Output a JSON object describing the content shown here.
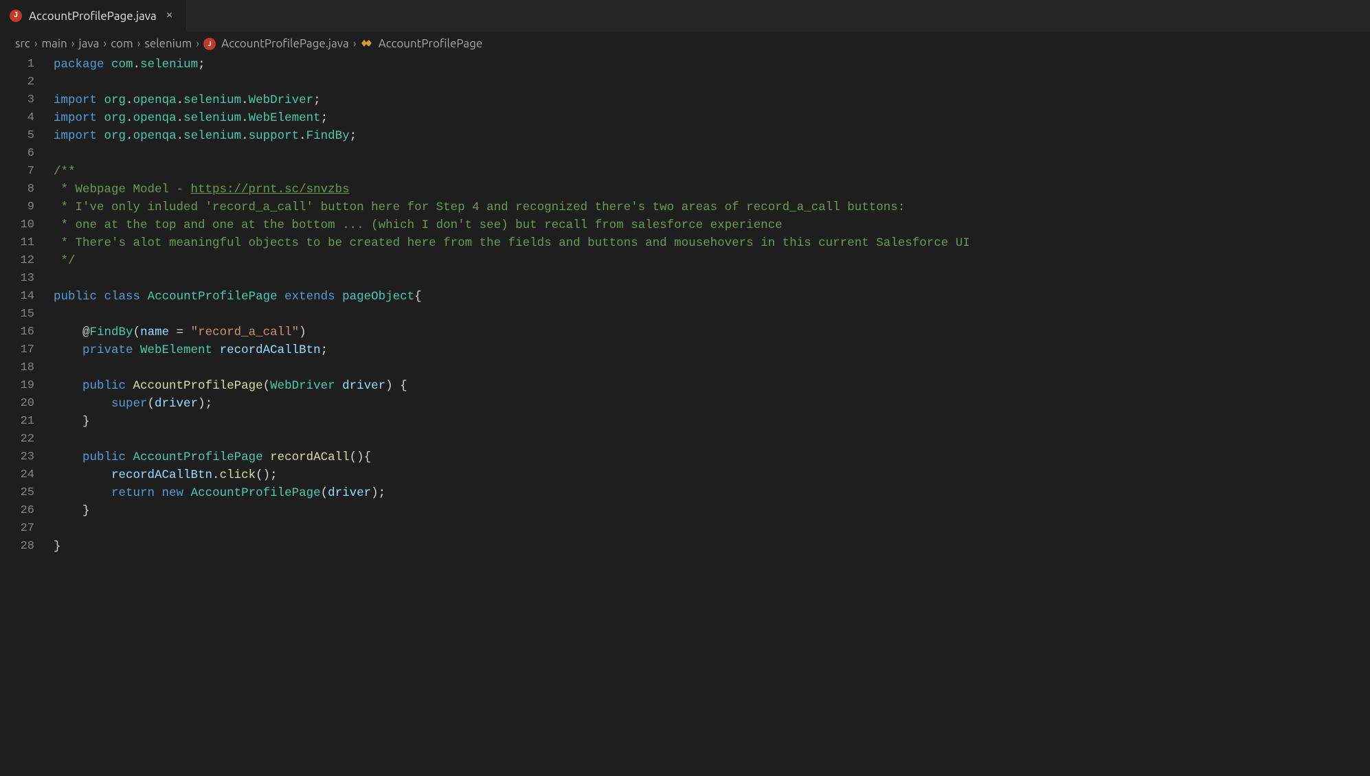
{
  "tab": {
    "label": "AccountProfilePage.java",
    "icon_letter": "J",
    "close_glyph": "×"
  },
  "breadcrumb": {
    "items": [
      "src",
      "main",
      "java",
      "com",
      "selenium"
    ],
    "file": "AccountProfilePage.java",
    "file_icon_letter": "J",
    "symbol": "AccountProfilePage"
  },
  "code": {
    "line_count": 28,
    "lines": {
      "l1_pkg_kw": "package",
      "l1_pkg_ns1": "com",
      "l1_pkg_ns2": "selenium",
      "l3_import_kw": "import",
      "l3_p1": "org",
      "l3_p2": "openqa",
      "l3_p3": "selenium",
      "l3_cls": "WebDriver",
      "l4_p1": "org",
      "l4_p2": "openqa",
      "l4_p3": "selenium",
      "l4_cls": "WebElement",
      "l5_p1": "org",
      "l5_p2": "openqa",
      "l5_p3": "selenium",
      "l5_p4": "support",
      "l5_cls": "FindBy",
      "l7_c": "/**",
      "l8_c_pre": " * Webpage Model - ",
      "l8_c_link": "https://prnt.sc/snvzbs",
      "l9_c": " * I've only inluded 'record_a_call' button here for Step 4 and recognized there's two areas of record_a_call buttons:",
      "l10_c": " * one at the top and one at the bottom ... (which I don't see) but recall from salesforce experience",
      "l11_c": " * There's alot meaningful objects to be created here from the fields and buttons and mousehovers in this current Salesforce UI",
      "l12_c": " */",
      "l14_public": "public",
      "l14_class": "class",
      "l14_name": "AccountProfilePage",
      "l14_ext": "extends",
      "l14_parent": "pageObject",
      "l16_at": "@",
      "l16_ann": "FindBy",
      "l16_argname": "name",
      "l16_eq": " = ",
      "l16_str": "\"record_a_call\"",
      "l17_priv": "private",
      "l17_type": "WebElement",
      "l17_var": "recordACallBtn",
      "l19_public": "public",
      "l19_name": "AccountProfilePage",
      "l19_ptype": "WebDriver",
      "l19_pvar": "driver",
      "l20_super": "super",
      "l20_arg": "driver",
      "l23_public": "public",
      "l23_type": "AccountProfilePage",
      "l23_fn": "recordACall",
      "l24_obj": "recordACallBtn",
      "l24_m": "click",
      "l25_ret": "return",
      "l25_new": "new",
      "l25_type": "AccountProfilePage",
      "l25_arg": "driver"
    }
  }
}
